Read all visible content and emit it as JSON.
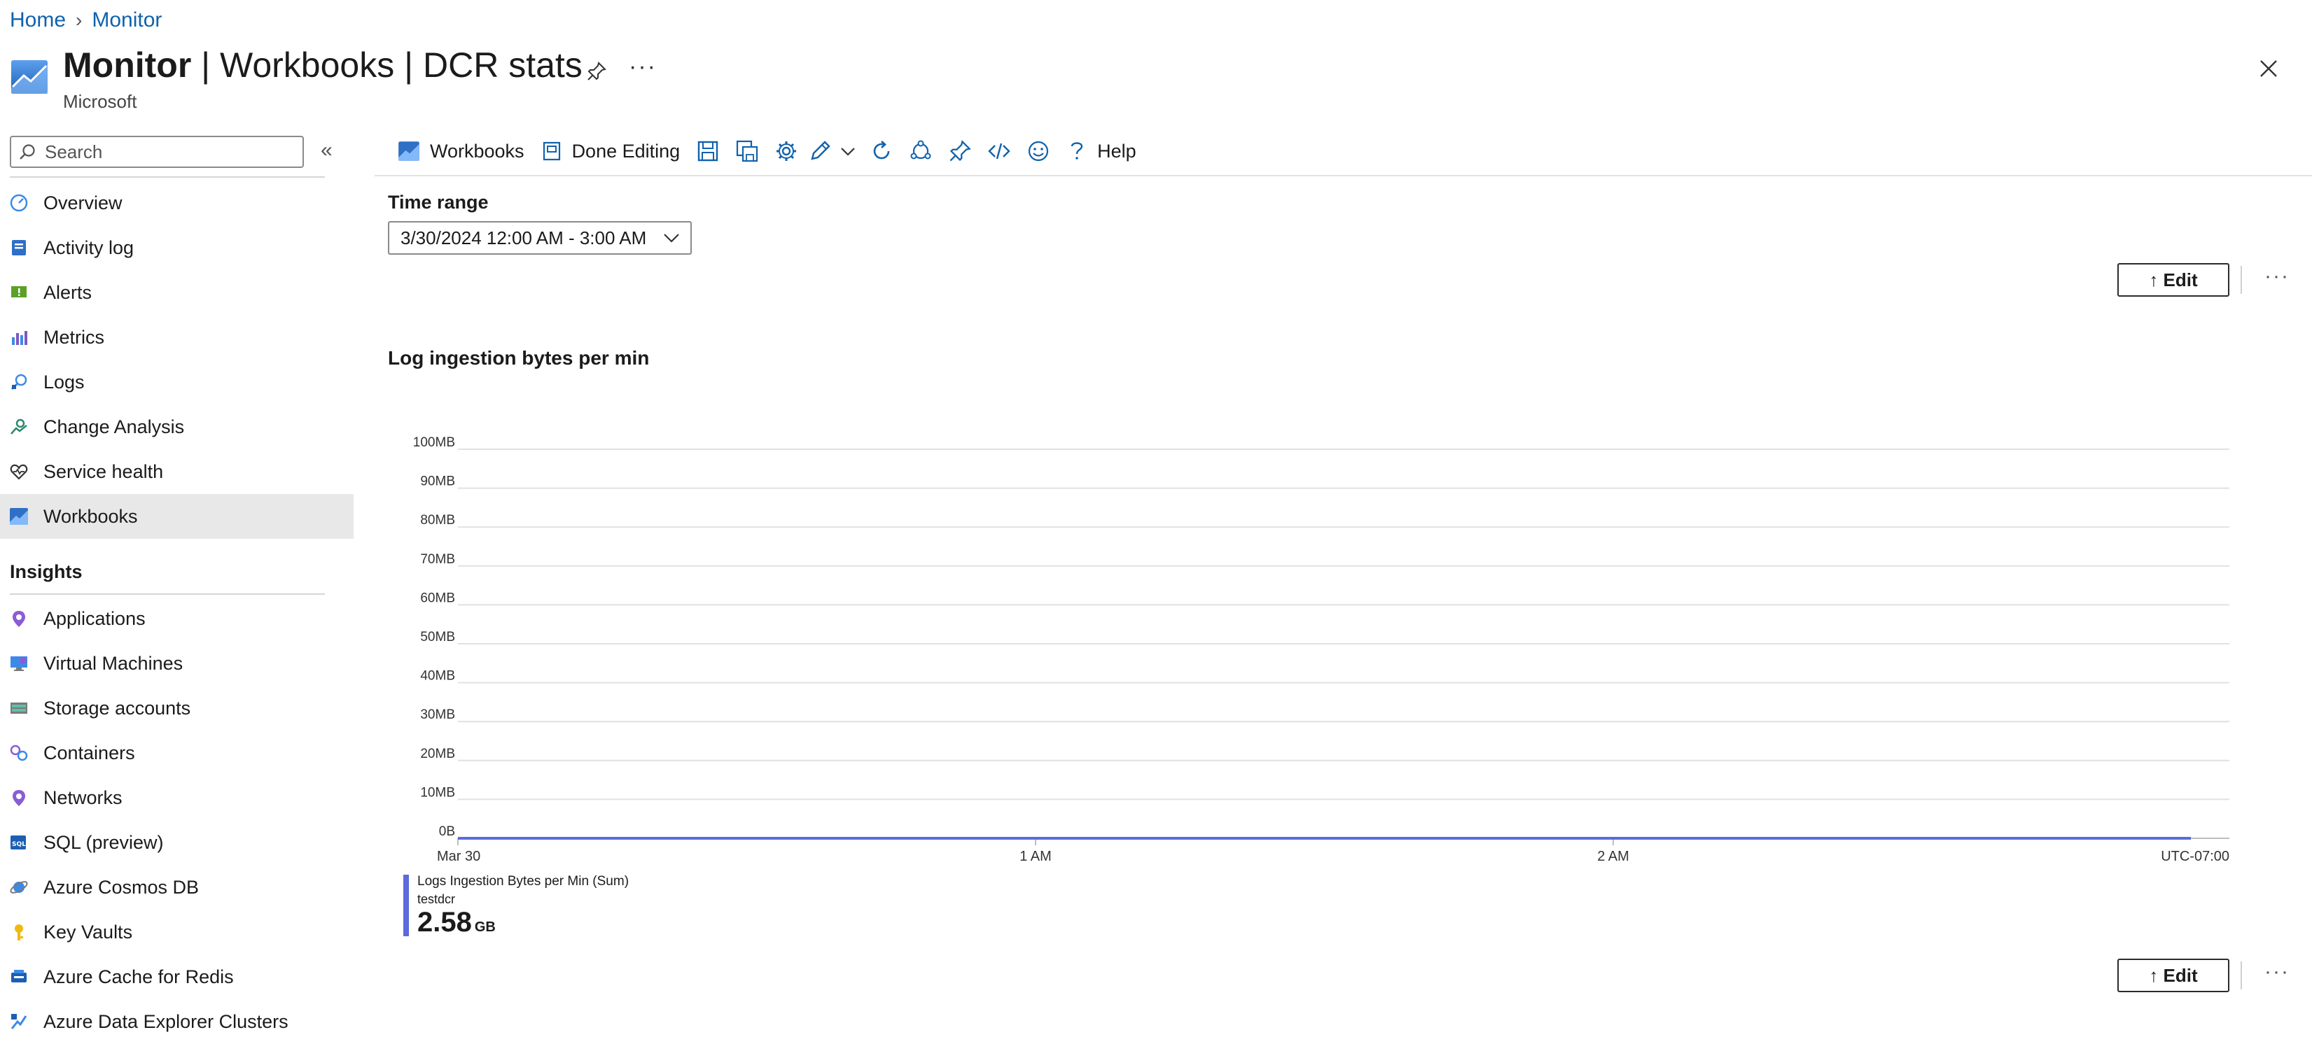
{
  "breadcrumb": {
    "home": "Home",
    "sep": "›",
    "current": "Monitor"
  },
  "header": {
    "title_main": "Monitor",
    "title_rest": " | Workbooks | DCR stats",
    "subtitle": "Microsoft",
    "more": "···"
  },
  "sidebar": {
    "search_placeholder": "Search",
    "collapse": "«",
    "items": [
      {
        "label": "Overview",
        "icon": "overview-icon",
        "active": false
      },
      {
        "label": "Activity log",
        "icon": "activity-log-icon",
        "active": false
      },
      {
        "label": "Alerts",
        "icon": "alerts-icon",
        "active": false
      },
      {
        "label": "Metrics",
        "icon": "metrics-icon",
        "active": false
      },
      {
        "label": "Logs",
        "icon": "logs-icon",
        "active": false
      },
      {
        "label": "Change Analysis",
        "icon": "change-analysis-icon",
        "active": false
      },
      {
        "label": "Service health",
        "icon": "service-health-icon",
        "active": false
      },
      {
        "label": "Workbooks",
        "icon": "workbooks-icon",
        "active": true
      }
    ],
    "insights_heading": "Insights",
    "insights": [
      {
        "label": "Applications",
        "icon": "applications-icon"
      },
      {
        "label": "Virtual Machines",
        "icon": "virtual-machines-icon"
      },
      {
        "label": "Storage accounts",
        "icon": "storage-accounts-icon"
      },
      {
        "label": "Containers",
        "icon": "containers-icon"
      },
      {
        "label": "Networks",
        "icon": "networks-icon"
      },
      {
        "label": "SQL (preview)",
        "icon": "sql-icon"
      },
      {
        "label": "Azure Cosmos DB",
        "icon": "cosmos-db-icon"
      },
      {
        "label": "Key Vaults",
        "icon": "key-vaults-icon"
      },
      {
        "label": "Azure Cache for Redis",
        "icon": "redis-cache-icon"
      },
      {
        "label": "Azure Data Explorer Clusters",
        "icon": "data-explorer-icon"
      }
    ]
  },
  "toolbar": {
    "workbooks": "Workbooks",
    "done_editing": "Done Editing",
    "help": "Help",
    "icons": [
      "save-icon",
      "save-as-icon",
      "settings-icon",
      "edit-pencil-icon",
      "chevron-down-icon",
      "refresh-icon",
      "share-icon",
      "pin-icon",
      "code-icon",
      "feedback-smiley-icon",
      "help-icon"
    ]
  },
  "params": {
    "time_range_label": "Time range",
    "time_range_value": "3/30/2024 12:00 AM - 3:00 AM"
  },
  "edit": {
    "label": "↑ Edit",
    "more": "···"
  },
  "chart": {
    "title": "Log ingestion bytes per min",
    "legend_name": "Logs Ingestion Bytes per Min (Sum)",
    "legend_sub": "testdcr",
    "total_value": "2.58",
    "total_unit": "GB"
  },
  "colors": {
    "accent": "#0f62ad",
    "series": "#5c6bdc",
    "grid": "#e1e1e1"
  },
  "chart_data": {
    "type": "line",
    "title": "Log ingestion bytes per min",
    "xlabel": "",
    "ylabel": "",
    "timezone_label": "UTC-07:00",
    "x_tick_labels": [
      "Mar 30",
      "1 AM",
      "2 AM"
    ],
    "x_tick_minutes": [
      0,
      60,
      120
    ],
    "xlim_minutes": [
      0,
      184
    ],
    "y_tick_labels": [
      "0B",
      "10MB",
      "20MB",
      "30MB",
      "40MB",
      "50MB",
      "60MB",
      "70MB",
      "80MB",
      "90MB",
      "100MB"
    ],
    "ylim": [
      0,
      100
    ],
    "y_unit": "MB",
    "grid": true,
    "legend_position": "bottom-left",
    "series": [
      {
        "name": "Logs Ingestion Bytes per Min (Sum)",
        "x": [
          0,
          5,
          10,
          15,
          20,
          25,
          30,
          35,
          40,
          45,
          50,
          55,
          60,
          65,
          70,
          75,
          80,
          85,
          90,
          95,
          100,
          105,
          110,
          115,
          120,
          125,
          130,
          135,
          140,
          145,
          150,
          155,
          160,
          165,
          170,
          175,
          180
        ],
        "y": [
          0,
          0,
          0,
          0,
          0,
          0,
          0,
          0,
          0,
          0,
          0,
          0,
          0,
          0,
          0,
          0,
          0,
          0,
          0,
          0,
          0,
          0,
          0,
          0,
          0,
          0,
          0,
          0,
          0,
          0,
          0,
          0,
          0,
          0,
          0,
          0,
          0
        ]
      }
    ]
  }
}
